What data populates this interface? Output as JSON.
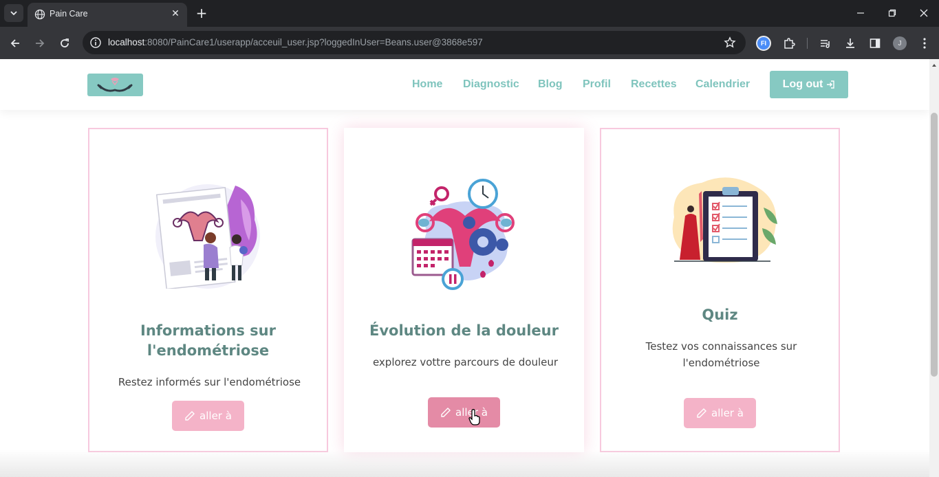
{
  "browser": {
    "tab_title": "Pain Care",
    "url_host": "localhost",
    "url_rest": ":8080/PainCare1/userapp/acceuil_user.jsp?loggedInUser=Beans.user@3868e597",
    "profile_initial": "J",
    "extension_initials": "FI"
  },
  "navbar": {
    "links": [
      "Home",
      "Diagnostic",
      "Blog",
      "Profil",
      "Recettes",
      "Calendrier"
    ],
    "logout_label": "Log out"
  },
  "cards": [
    {
      "title_line1": "Informations sur",
      "title_line2": "l'endométriose",
      "description": "Restez informés sur l'endométriose",
      "button_label": "aller à"
    },
    {
      "title_line1": "Évolution de la douleur",
      "description": "explorez vottre parcours de douleur",
      "button_label": "aller à"
    },
    {
      "title_line1": "Quiz",
      "description": "Testez vos connaissances sur l'endométriose",
      "button_label": "aller à"
    }
  ],
  "colors": {
    "accent_teal": "#86c9c2",
    "card_border_pink": "#f7c9de",
    "button_pink": "#f4b3c8",
    "button_pink_hover": "#e48ba6",
    "title_teal_dark": "#5e8782"
  }
}
